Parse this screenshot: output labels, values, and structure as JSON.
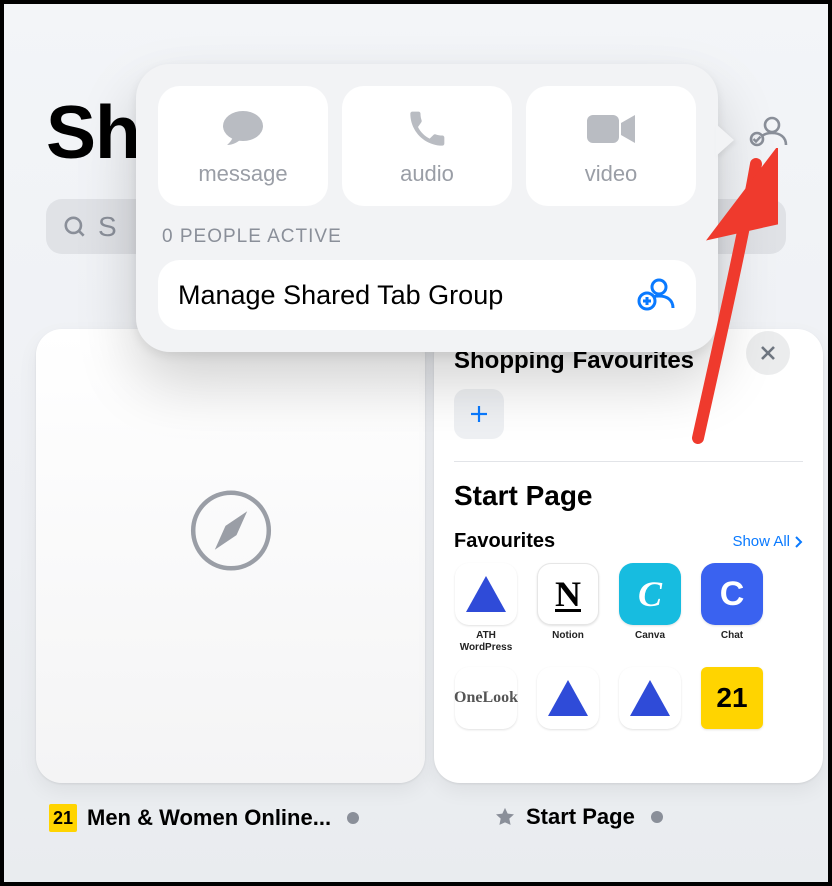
{
  "title_fragment": "Sh",
  "search_placeholder_fragment": "S",
  "collab": {
    "icon": "shared-group-icon"
  },
  "popover": {
    "buttons": [
      {
        "id": "message",
        "label": "message"
      },
      {
        "id": "audio",
        "label": "audio"
      },
      {
        "id": "video",
        "label": "video"
      }
    ],
    "status": "0 PEOPLE ACTIVE",
    "manage_label": "Manage Shared Tab Group"
  },
  "startpage": {
    "shopping_favs_label": "Shopping",
    "shopping_favs_label2": "Favourites",
    "big_title": "Start Page",
    "favs_label": "Favourites",
    "show_all": "Show All",
    "fav_items": [
      {
        "cap": "ATH WordPress",
        "kind": "tri"
      },
      {
        "cap": "Notion",
        "kind": "notion"
      },
      {
        "cap": "Canva",
        "kind": "canva"
      },
      {
        "cap": "Chat",
        "kind": "chat"
      }
    ],
    "fav_items2": [
      {
        "cap": "OneLook",
        "kind": "onelook"
      },
      {
        "cap": "",
        "kind": "tri"
      },
      {
        "cap": "",
        "kind": "tri"
      },
      {
        "cap": "",
        "kind": "21"
      }
    ]
  },
  "tabs": {
    "left": {
      "label": "Men & Women Online...",
      "badge": "21"
    },
    "right": {
      "label": "Start Page"
    }
  },
  "glyphs": {
    "onelook": "OneLook",
    "twentyone": "21"
  }
}
